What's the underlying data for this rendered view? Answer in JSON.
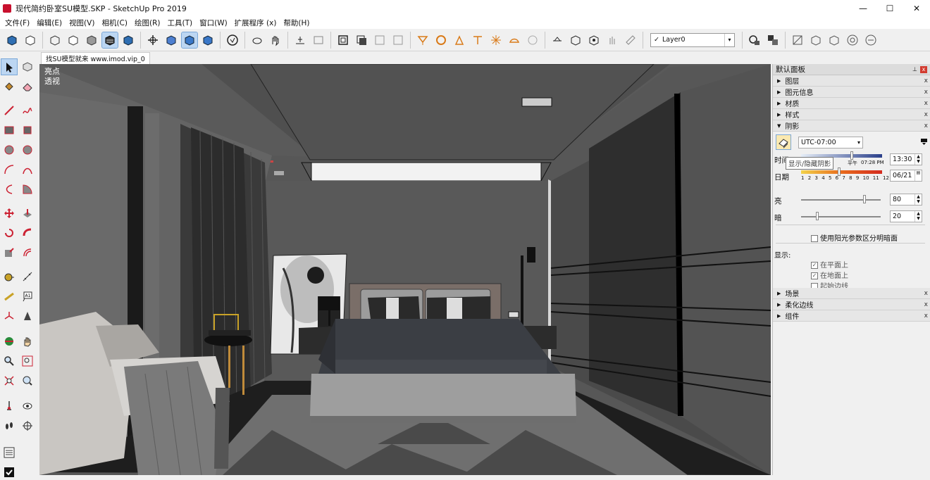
{
  "window": {
    "title": "现代简约卧室SU模型.SKP - SketchUp Pro 2019",
    "minimize_glyph": "—",
    "maximize_glyph": "☐",
    "close_glyph": "✕"
  },
  "menu": [
    "文件(F)",
    "编辑(E)",
    "视图(V)",
    "相机(C)",
    "绘图(R)",
    "工具(T)",
    "窗口(W)",
    "扩展程序 (x)",
    "帮助(H)"
  ],
  "toolbar": {
    "layer_value": "Layer0",
    "layer_check": "✓",
    "dropdown_glyph": "▾"
  },
  "tab": {
    "label": "找SU模型就来 www.imod.vip_0"
  },
  "viewport": {
    "label_line1": "亮点",
    "label_line2": "透视"
  },
  "tray": {
    "title": "默认面板",
    "pin": "⊥",
    "close": "x",
    "sections_top": [
      {
        "label": "图层",
        "arrow": "▶"
      },
      {
        "label": "图元信息",
        "arrow": "▶"
      },
      {
        "label": "材质",
        "arrow": "▶"
      },
      {
        "label": "样式",
        "arrow": "▶"
      }
    ],
    "shadow": {
      "label": "阴影",
      "arrow": "▼",
      "timezone": "UTC-07:00",
      "time_label": "时间",
      "time_value": "13:30",
      "time_left_mark": "平午",
      "time_right_mark": "07:28 PM",
      "date_label": "日期",
      "date_value": "06/21",
      "months": [
        "1",
        "2",
        "3",
        "4",
        "5",
        "6",
        "7",
        "8",
        "9",
        "10",
        "11",
        "12"
      ],
      "light_label": "亮",
      "light_value": "80",
      "light_fraction": 0.8,
      "dark_label": "暗",
      "dark_value": "20",
      "dark_fraction": 0.2,
      "use_sun_label": "使用阳光参数区分明暗面",
      "display_label": "显示:",
      "on_faces": "在平面上",
      "on_ground": "在地面上",
      "from_edges": "起始边线",
      "tooltip": "显示/隐藏阴影",
      "check_glyph": "✓"
    },
    "sections_bottom": [
      {
        "label": "场景",
        "arrow": "▶"
      },
      {
        "label": "柔化边线",
        "arrow": "▶"
      },
      {
        "label": "组件",
        "arrow": "▶"
      }
    ]
  }
}
